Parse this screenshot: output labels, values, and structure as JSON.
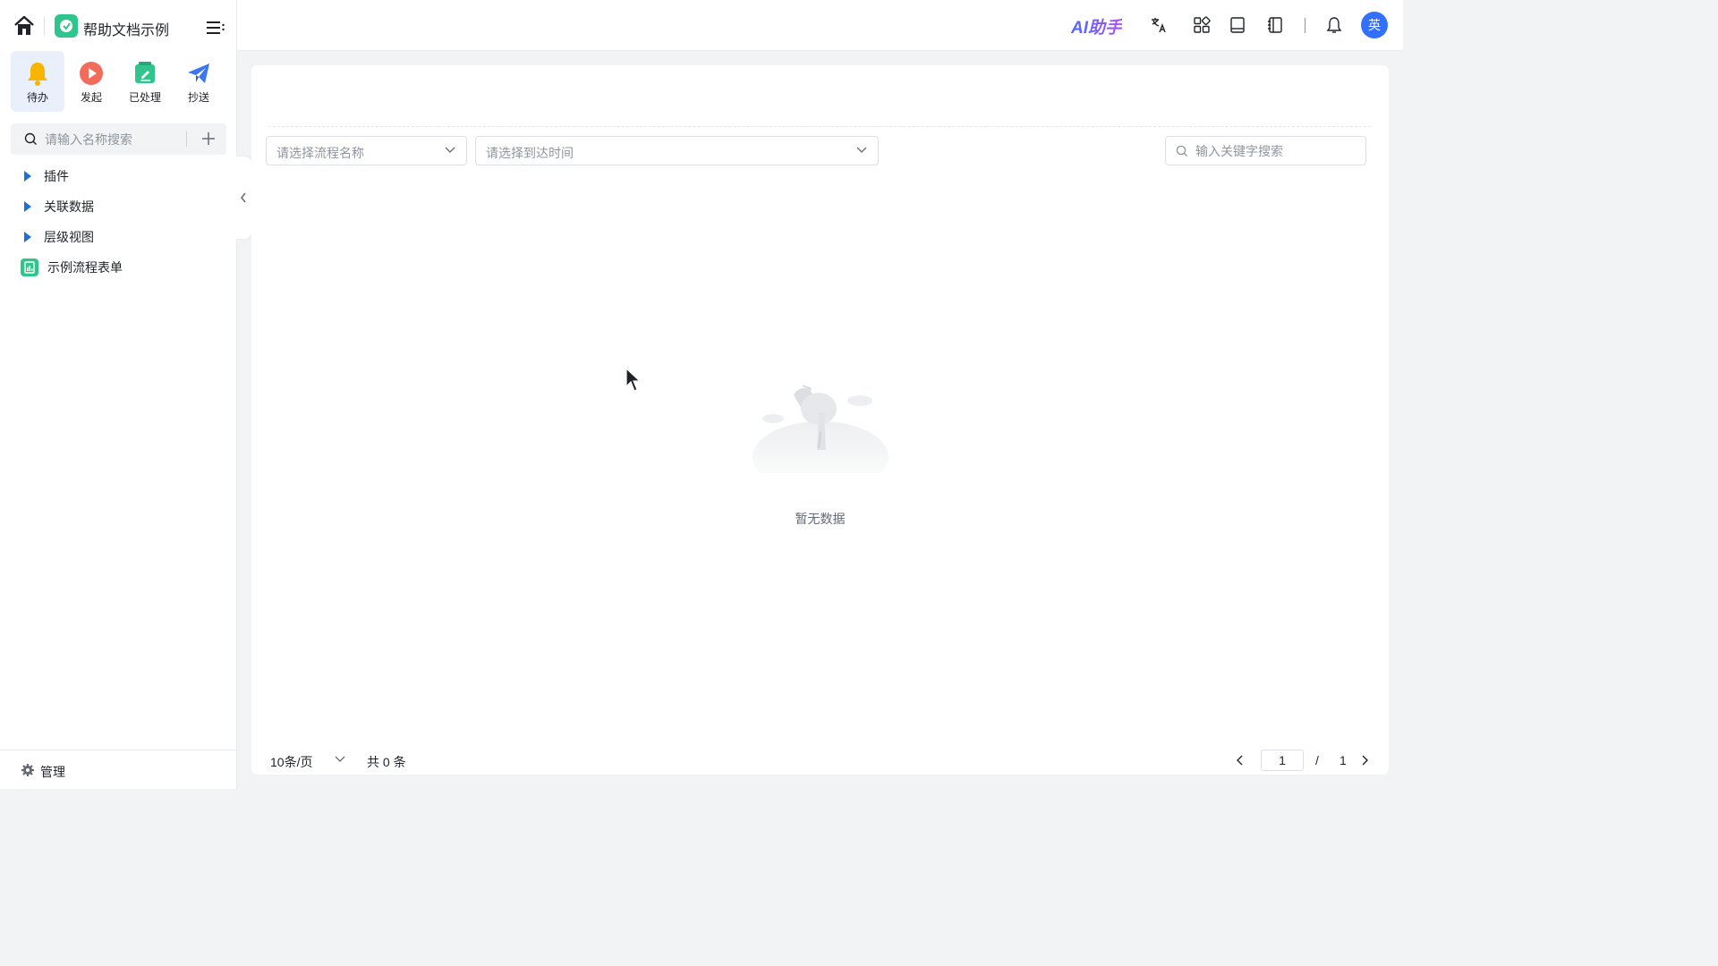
{
  "brand": {
    "app_name": "帮助文档示例"
  },
  "quick_actions": [
    {
      "label": "待办",
      "icon": "bell-icon",
      "color": "#f7b500",
      "active": true
    },
    {
      "label": "发起",
      "icon": "play-icon",
      "color": "#f26b5b",
      "active": false
    },
    {
      "label": "已处理",
      "icon": "edit-icon",
      "color": "#2fc58d",
      "active": false
    },
    {
      "label": "抄送",
      "icon": "send-icon",
      "color": "#3370ff",
      "active": false
    }
  ],
  "sidebar": {
    "search_placeholder": "请输入名称搜索",
    "tree": [
      {
        "label": "插件",
        "type": "folder"
      },
      {
        "label": "关联数据",
        "type": "folder"
      },
      {
        "label": "层级视图",
        "type": "folder"
      },
      {
        "label": "示例流程表单",
        "type": "form"
      }
    ],
    "manage_label": "管理"
  },
  "topbar": {
    "ai_label": "AI助手",
    "avatar_text": "英",
    "accent": "#3370ff"
  },
  "filters": {
    "process_placeholder": "请选择流程名称",
    "time_placeholder": "请选择到达时间",
    "search_placeholder": "输入关键字搜索"
  },
  "empty": {
    "text": "暂无数据"
  },
  "pagination": {
    "page_size": "10条/页",
    "total": "共 0 条",
    "current": "1",
    "separator": "/",
    "pages": "1"
  }
}
